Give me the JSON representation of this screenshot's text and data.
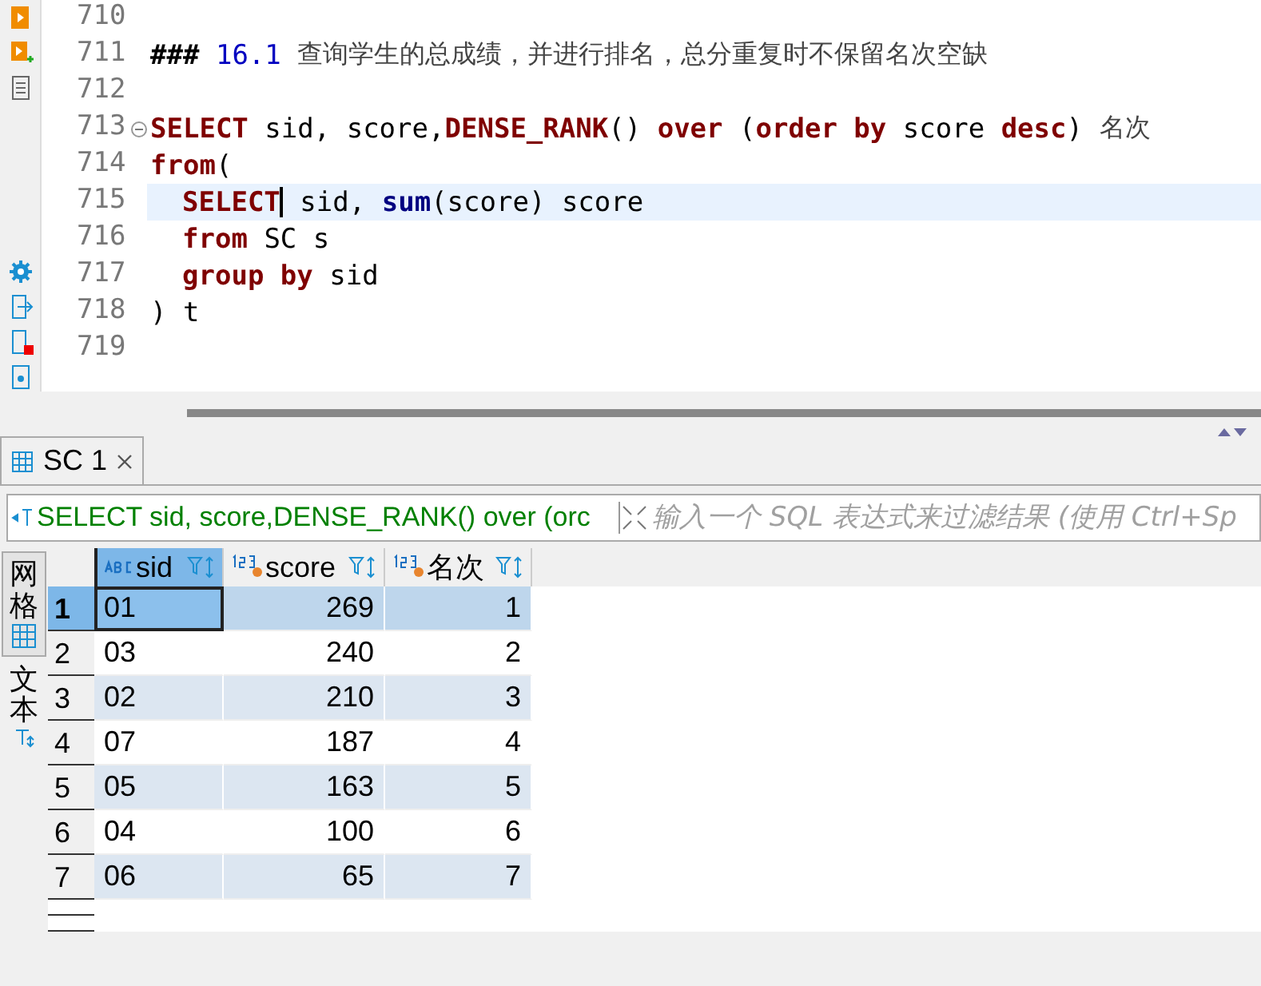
{
  "editor": {
    "lines": [
      {
        "number": "710"
      },
      {
        "number": "711",
        "tokens": [
          {
            "kind": "heading",
            "text": "### "
          },
          {
            "kind": "number",
            "text": "16.1 "
          },
          {
            "kind": "cjk",
            "text": "查询学生的总成绩，并进行排名，总分重复时不保留名次空缺"
          }
        ]
      },
      {
        "number": "712"
      },
      {
        "number": "713",
        "foldable": true,
        "tokens": [
          {
            "kind": "keyword",
            "text": "SELECT"
          },
          {
            "kind": "plain",
            "text": " sid, score,"
          },
          {
            "kind": "keyword",
            "text": "DENSE_RANK"
          },
          {
            "kind": "plain",
            "text": "() "
          },
          {
            "kind": "keyword",
            "text": "over"
          },
          {
            "kind": "plain",
            "text": " ("
          },
          {
            "kind": "keyword",
            "text": "order by"
          },
          {
            "kind": "plain",
            "text": " score "
          },
          {
            "kind": "keyword",
            "text": "desc"
          },
          {
            "kind": "plain",
            "text": ") "
          },
          {
            "kind": "cjk",
            "text": "名次"
          }
        ]
      },
      {
        "number": "714",
        "tokens": [
          {
            "kind": "keyword",
            "text": "from"
          },
          {
            "kind": "plain",
            "text": "("
          }
        ]
      },
      {
        "number": "715",
        "current": true,
        "indented": true,
        "tokens": [
          {
            "kind": "keyword",
            "text": "SELECT",
            "caret": true
          },
          {
            "kind": "plain",
            "text": " sid, "
          },
          {
            "kind": "function",
            "text": "sum"
          },
          {
            "kind": "plain",
            "text": "(score) score"
          }
        ]
      },
      {
        "number": "716",
        "indented": true,
        "tokens": [
          {
            "kind": "keyword",
            "text": "from"
          },
          {
            "kind": "plain",
            "text": " SC s"
          }
        ]
      },
      {
        "number": "717",
        "indented": true,
        "tokens": [
          {
            "kind": "keyword",
            "text": "group by"
          },
          {
            "kind": "plain",
            "text": " sid"
          }
        ]
      },
      {
        "number": "718",
        "tokens": [
          {
            "kind": "plain",
            "text": ") t"
          }
        ]
      },
      {
        "number": "719"
      }
    ]
  },
  "results": {
    "tabs": [
      {
        "label": "SC 1",
        "selected": true
      }
    ],
    "filter": {
      "query": "SELECT sid, score,DENSE_RANK() over (orc",
      "placeholder": "输入一个 SQL 表达式来过滤结果 (使用 Ctrl+Sp"
    },
    "views": [
      {
        "label": "网格",
        "kind": "grid",
        "selected": true
      },
      {
        "label": "文本",
        "kind": "text",
        "selected": false
      }
    ],
    "columns": [
      {
        "name": "sid",
        "kind": "string",
        "selected": true
      },
      {
        "name": "score",
        "kind": "number",
        "selected": false
      },
      {
        "name": "名次",
        "kind": "number",
        "selected": false
      }
    ],
    "rows": [
      {
        "number": "1",
        "selected": true,
        "cells": [
          "01",
          "269",
          "1"
        ]
      },
      {
        "number": "2",
        "selected": false,
        "cells": [
          "03",
          "240",
          "2"
        ]
      },
      {
        "number": "3",
        "selected": false,
        "cells": [
          "02",
          "210",
          "3"
        ]
      },
      {
        "number": "4",
        "selected": false,
        "cells": [
          "07",
          "187",
          "4"
        ]
      },
      {
        "number": "5",
        "selected": false,
        "cells": [
          "05",
          "163",
          "5"
        ]
      },
      {
        "number": "6",
        "selected": false,
        "cells": [
          "04",
          "100",
          "6"
        ]
      },
      {
        "number": "7",
        "selected": false,
        "cells": [
          "06",
          "65",
          "7"
        ]
      }
    ]
  }
}
